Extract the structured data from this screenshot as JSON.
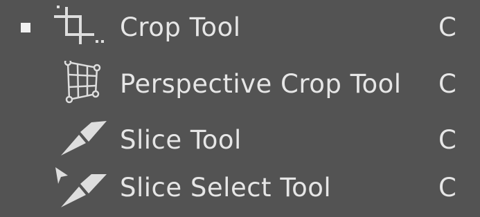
{
  "colors": {
    "background": "#535353",
    "text": "#e6e6e6",
    "icon": "#dedede"
  },
  "tools": [
    {
      "label": "Crop Tool",
      "shortcut": "C",
      "icon": "crop-icon",
      "active": true
    },
    {
      "label": "Perspective Crop Tool",
      "shortcut": "C",
      "icon": "perspective-crop-icon",
      "active": false
    },
    {
      "label": "Slice Tool",
      "shortcut": "C",
      "icon": "slice-icon",
      "active": false
    },
    {
      "label": "Slice Select Tool",
      "shortcut": "C",
      "icon": "slice-select-icon",
      "active": false
    }
  ]
}
